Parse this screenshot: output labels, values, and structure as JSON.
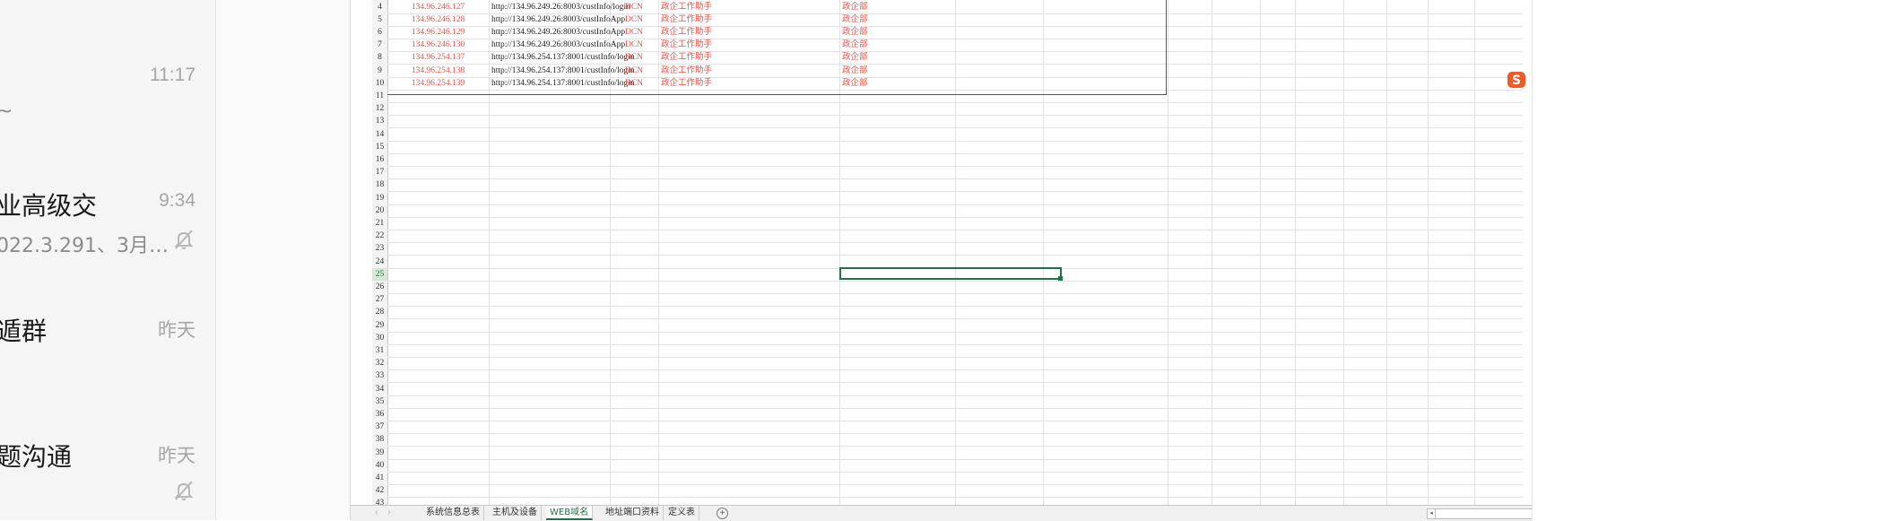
{
  "chat_list": [
    {
      "name": "",
      "preview": "~",
      "time": "11:17",
      "muted": false
    },
    {
      "name": "业高级交",
      "preview": "022.3.291、3月…",
      "time": "9:34",
      "muted": true
    },
    {
      "name": "遁群",
      "preview": "",
      "time": "昨天",
      "muted": false
    },
    {
      "name": "题沟通",
      "preview": "",
      "time": "昨天",
      "muted": true
    }
  ],
  "spreadsheet": {
    "data_rows": [
      {
        "row": "4",
        "ip": "134.96.246.127",
        "url": "http://134.96.249.26:8003/custInfo/login",
        "net": "DCN",
        "app": "政企工作助手",
        "dept": "政企部"
      },
      {
        "row": "5",
        "ip": "134.96.246.128",
        "url": "http://134.96.249.26:8003/custInfoApp",
        "net": "DCN",
        "app": "政企工作助手",
        "dept": "政企部"
      },
      {
        "row": "6",
        "ip": "134.96.246.129",
        "url": "http://134.96.249.26:8003/custInfoApp",
        "net": "DCN",
        "app": "政企工作助手",
        "dept": "政企部"
      },
      {
        "row": "7",
        "ip": "134.96.246.130",
        "url": "http://134.96.249.26:8003/custInfoApp",
        "net": "DCN",
        "app": "政企工作助手",
        "dept": "政企部"
      },
      {
        "row": "8",
        "ip": "134.96.254.137",
        "url": "http://134.96.254.137:8001/custInfo/login",
        "net": "DCN",
        "app": "政企工作助手",
        "dept": "政企部"
      },
      {
        "row": "9",
        "ip": "134.96.254.138",
        "url": "http://134.96.254.137:8001/custInfo/login",
        "net": "DCN",
        "app": "政企工作助手",
        "dept": "政企部"
      },
      {
        "row": "10",
        "ip": "134.96.254.139",
        "url": "http://134.96.254.137:8001/custInfo/login",
        "net": "DCN",
        "app": "政企工作助手",
        "dept": "政企部"
      }
    ],
    "empty_rows": [
      "11",
      "12",
      "13",
      "14",
      "15",
      "16",
      "17",
      "18",
      "19",
      "20",
      "21",
      "22",
      "23",
      "24",
      "25",
      "26",
      "27",
      "28",
      "29",
      "30",
      "31",
      "32",
      "33",
      "34",
      "35",
      "36",
      "37",
      "38",
      "39",
      "40",
      "41",
      "42",
      "43"
    ],
    "active_row": "25",
    "tabs": [
      "系统信息总表",
      "主机及设备",
      "WEB域名",
      "地址端口资料",
      "定义表"
    ],
    "active_tab": "WEB域名",
    "add_sheet_symbol": "+"
  },
  "colors": {
    "accent": "#217346",
    "red_text": "#e8534a"
  },
  "icons": [
    "mute-bell-icon",
    "add-sheet-icon",
    "sogou-ime-icon",
    "scroll-left-icon"
  ]
}
